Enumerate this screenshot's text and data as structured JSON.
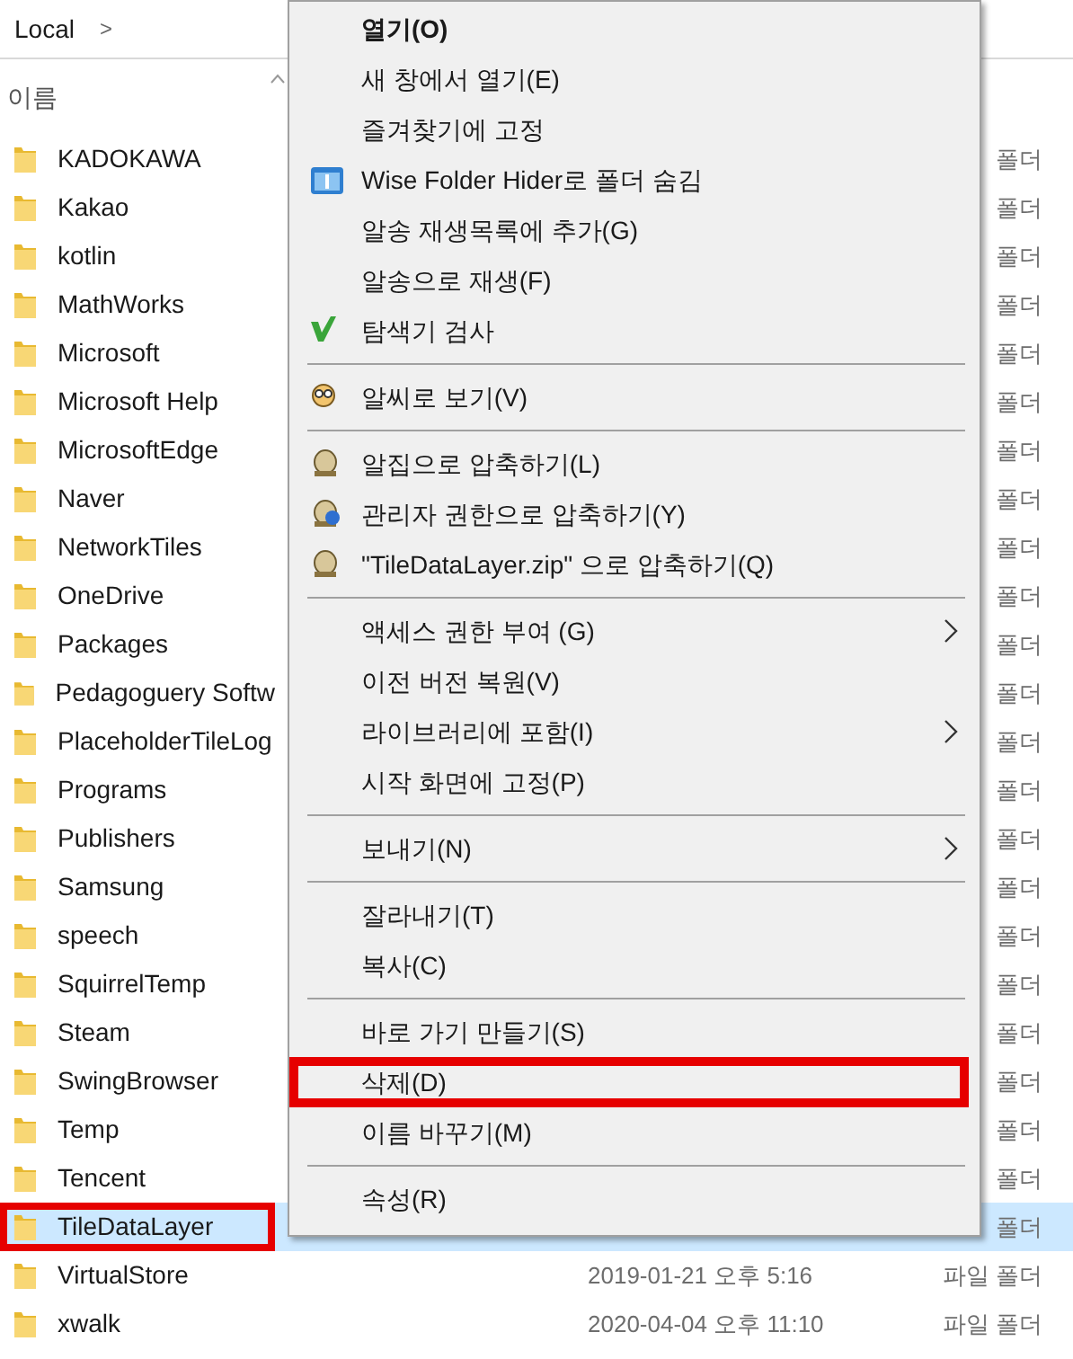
{
  "breadcrumb": {
    "segment": "Local",
    "separator": ">"
  },
  "columns": {
    "name": "이름"
  },
  "rows": [
    {
      "name": "KADOKAWA",
      "type": "폴더",
      "selected": false,
      "highlighted": false
    },
    {
      "name": "Kakao",
      "type": "폴더",
      "selected": false,
      "highlighted": false
    },
    {
      "name": "kotlin",
      "type": "폴더",
      "selected": false,
      "highlighted": false
    },
    {
      "name": "MathWorks",
      "type": "폴더",
      "selected": false,
      "highlighted": false
    },
    {
      "name": "Microsoft",
      "type": "폴더",
      "selected": false,
      "highlighted": false
    },
    {
      "name": "Microsoft Help",
      "type": "폴더",
      "selected": false,
      "highlighted": false
    },
    {
      "name": "MicrosoftEdge",
      "type": "폴더",
      "selected": false,
      "highlighted": false
    },
    {
      "name": "Naver",
      "type": "폴더",
      "selected": false,
      "highlighted": false
    },
    {
      "name": "NetworkTiles",
      "type": "폴더",
      "selected": false,
      "highlighted": false
    },
    {
      "name": "OneDrive",
      "type": "폴더",
      "selected": false,
      "highlighted": false
    },
    {
      "name": "Packages",
      "type": "폴더",
      "selected": false,
      "highlighted": false
    },
    {
      "name": "Pedagoguery Softw",
      "type": "폴더",
      "selected": false,
      "highlighted": false
    },
    {
      "name": "PlaceholderTileLog",
      "type": "폴더",
      "selected": false,
      "highlighted": false
    },
    {
      "name": "Programs",
      "type": "폴더",
      "selected": false,
      "highlighted": false
    },
    {
      "name": "Publishers",
      "type": "폴더",
      "selected": false,
      "highlighted": false
    },
    {
      "name": "Samsung",
      "type": "폴더",
      "selected": false,
      "highlighted": false
    },
    {
      "name": "speech",
      "type": "폴더",
      "selected": false,
      "highlighted": false
    },
    {
      "name": "SquirrelTemp",
      "type": "폴더",
      "selected": false,
      "highlighted": false
    },
    {
      "name": "Steam",
      "type": "폴더",
      "selected": false,
      "highlighted": false
    },
    {
      "name": "SwingBrowser",
      "type": "폴더",
      "selected": false,
      "highlighted": false
    },
    {
      "name": "Temp",
      "type": "폴더",
      "selected": false,
      "highlighted": false
    },
    {
      "name": "Tencent",
      "type": "폴더",
      "selected": false,
      "highlighted": false
    },
    {
      "name": "TileDataLayer",
      "type": "폴더",
      "selected": true,
      "highlighted": true
    },
    {
      "name": "VirtualStore",
      "date": "2019-01-21 오후 5:16",
      "type": "파일 폴더",
      "selected": false,
      "highlighted": false
    },
    {
      "name": "xwalk",
      "date": "2020-04-04 오후 11:10",
      "type": "파일 폴더",
      "selected": false,
      "highlighted": false
    }
  ],
  "context_menu": [
    {
      "kind": "item",
      "label": "열기(O)",
      "bold": true
    },
    {
      "kind": "item",
      "label": "새 창에서 열기(E)"
    },
    {
      "kind": "item",
      "label": "즐겨찾기에 고정"
    },
    {
      "kind": "hider",
      "label": "Wise Folder Hider로 폴더 숨김"
    },
    {
      "kind": "item",
      "label": "알송 재생목록에 추가(G)"
    },
    {
      "kind": "item",
      "label": "알송으로 재생(F)"
    },
    {
      "kind": "scan",
      "label": "탐색기 검사"
    },
    {
      "kind": "separator"
    },
    {
      "kind": "viewer",
      "label": "알씨로 보기(V)"
    },
    {
      "kind": "separator"
    },
    {
      "kind": "archive",
      "label": "알집으로 압축하기(L)"
    },
    {
      "kind": "adminarchive",
      "label": "관리자 권한으로 압축하기(Y)"
    },
    {
      "kind": "archive",
      "label": "\"TileDataLayer.zip\" 으로 압축하기(Q)"
    },
    {
      "kind": "separator"
    },
    {
      "kind": "item",
      "label": "액세스 권한 부여 (G)",
      "submenu": true
    },
    {
      "kind": "item",
      "label": "이전 버전 복원(V)"
    },
    {
      "kind": "item",
      "label": "라이브러리에 포함(I)",
      "submenu": true
    },
    {
      "kind": "item",
      "label": "시작 화면에 고정(P)"
    },
    {
      "kind": "separator"
    },
    {
      "kind": "item",
      "label": "보내기(N)",
      "submenu": true
    },
    {
      "kind": "separator"
    },
    {
      "kind": "item",
      "label": "잘라내기(T)"
    },
    {
      "kind": "item",
      "label": "복사(C)"
    },
    {
      "kind": "separator"
    },
    {
      "kind": "item",
      "label": "바로 가기 만들기(S)"
    },
    {
      "kind": "item",
      "label": "삭제(D)",
      "highlighted": true
    },
    {
      "kind": "item",
      "label": "이름 바꾸기(M)"
    },
    {
      "kind": "separator"
    },
    {
      "kind": "item",
      "label": "속성(R)"
    }
  ]
}
